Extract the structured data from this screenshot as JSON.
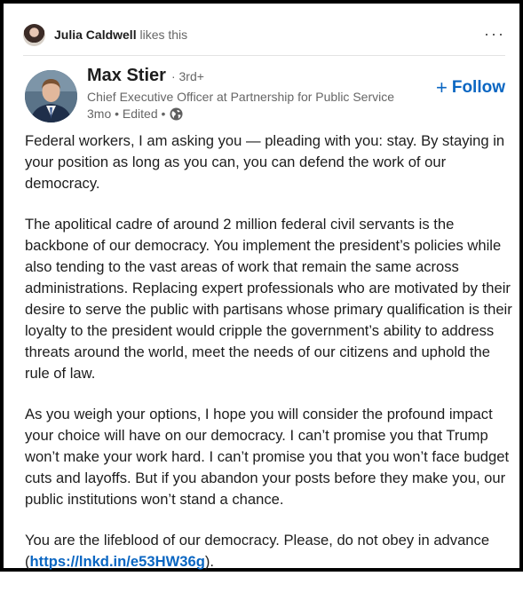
{
  "activity": {
    "liker_name": "Julia Caldwell",
    "action": " likes this",
    "more_label": "···"
  },
  "author": {
    "name": "Max Stier",
    "degree": "· 3rd+",
    "headline": "Chief Executive Officer at Partnership for Public Service",
    "time": "3mo • Edited •",
    "follow_label": "Follow",
    "follow_icon": "+"
  },
  "post": {
    "paragraphs": [
      "Federal workers, I am asking you — pleading with you: stay. By staying in your position as long as you can, you can defend the work of our democracy.",
      "The apolitical cadre of around 2 million federal civil servants is the backbone of our democracy. You implement the president’s policies while also tending to the vast areas of work that remain the same across administrations. Replacing expert professionals who are motivated by their desire to serve the public with partisans whose primary qualification is their loyalty to the president would cripple the government’s ability to address threats around the world, meet the needs of our citizens and uphold the rule of law.",
      "As you weigh your options, I hope you will consider the profound impact your choice will have on our democracy. I can’t promise you that Trump won’t make your work hard. I can’t promise you that you won’t face budget cuts and layoffs. But if you abandon your posts before they make you, our public institutions won’t stand a chance.",
      "You are the lifeblood of our democracy. Please, do not obey in advance"
    ],
    "link_open": "(",
    "link_text": "https://lnkd.in/e53HW36g",
    "link_close": ")."
  },
  "colors": {
    "accent": "#0a66c2",
    "text": "#1d1d1d",
    "muted": "#666666"
  },
  "icons": {
    "more": "ellipsis-icon",
    "visibility": "globe-icon"
  }
}
